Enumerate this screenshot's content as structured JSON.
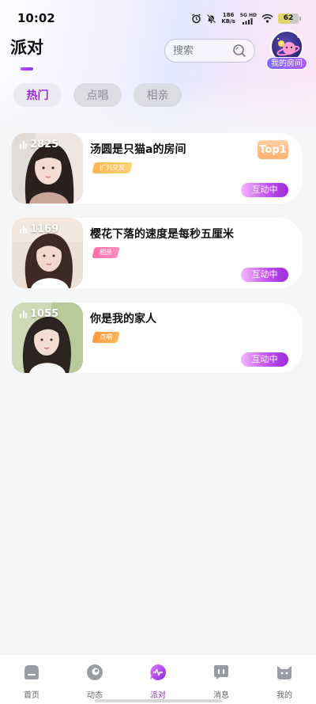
{
  "status_bar": {
    "time": "10:02",
    "net_speed_value": "186",
    "net_speed_unit": "KB/s",
    "net_type": "5G HD",
    "battery": "62"
  },
  "header": {
    "title": "派对",
    "search_placeholder": "搜索",
    "my_room_label": "我的房间"
  },
  "tabs": [
    {
      "label": "热门",
      "active": true
    },
    {
      "label": "点唱",
      "active": false
    },
    {
      "label": "相亲",
      "active": false
    }
  ],
  "rooms": [
    {
      "count": "2825",
      "title": "汤圆是只猫a的房间",
      "tag": "扩列交友",
      "rank": "Top1",
      "status": "互动中"
    },
    {
      "count": "1169",
      "title": "樱花下落的速度是每秒五厘米",
      "tag": "相亲",
      "status": "互动中"
    },
    {
      "count": "1055",
      "title": "你是我的家人",
      "tag": "点唱",
      "status": "互动中"
    }
  ],
  "bottom_nav": [
    {
      "label": "首页",
      "icon": "home-icon"
    },
    {
      "label": "动态",
      "icon": "moments-icon"
    },
    {
      "label": "派对",
      "icon": "party-icon"
    },
    {
      "label": "消息",
      "icon": "message-icon"
    },
    {
      "label": "我的",
      "icon": "profile-icon"
    }
  ],
  "colors": {
    "accent": "#9a2bd9",
    "tab_inactive_bg": "#dcdde3",
    "page_bg": "#f5f6f8"
  }
}
